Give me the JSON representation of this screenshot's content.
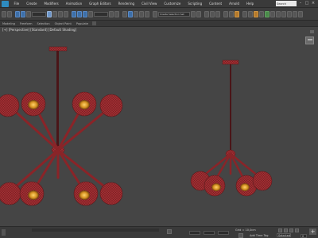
{
  "menubar": {
    "items": [
      "File",
      "Create",
      "Modifiers",
      "Animation",
      "Graph Editors",
      "Rendering",
      "Civil View",
      "Customize",
      "Scripting",
      "Content",
      "Arnold",
      "Help"
    ],
    "search_placeholder": "Search",
    "window_buttons": [
      "–",
      "□",
      "×"
    ]
  },
  "toolbar": {
    "selection_set_placeholder": "Create Selection Set"
  },
  "ribbon": {
    "tabs": [
      "Modeling",
      "Freeform",
      "Selection",
      "Object Paint",
      "Populate"
    ]
  },
  "viewport": {
    "label": "[+] [Perspective] [Standard] [Default Shading]"
  },
  "statusbar": {
    "grid_text": "Grid = 10,0cm",
    "add_time_tag": "Add Time Tag",
    "selected_label": "Selected",
    "frame_value": "0",
    "add_button": "+"
  },
  "colors": {
    "model_red": "#9c2a2e",
    "model_dark": "#5a1a1c",
    "bulb_glow": "#e0a020",
    "viewport_bg": "#454545"
  }
}
